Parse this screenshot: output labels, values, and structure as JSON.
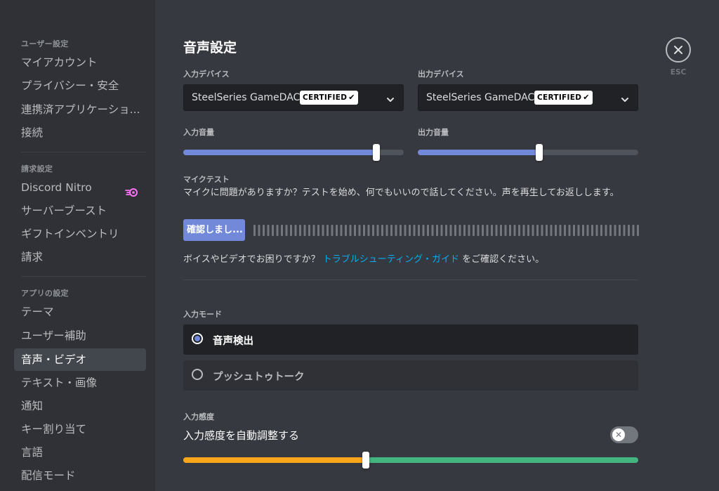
{
  "sidebar": {
    "sections": [
      {
        "label": "ユーザー設定"
      },
      {
        "label": "請求設定"
      },
      {
        "label": "アプリの設定"
      }
    ],
    "items": [
      {
        "label": "マイアカウント"
      },
      {
        "label": "プライバシー・安全"
      },
      {
        "label": "連携済アプリケーショ..."
      },
      {
        "label": "接続"
      },
      {
        "label": "Discord Nitro",
        "icon": "nitro-icon"
      },
      {
        "label": "サーバーブースト"
      },
      {
        "label": "ギフトインベントリ"
      },
      {
        "label": "請求"
      },
      {
        "label": "テーマ"
      },
      {
        "label": "ユーザー補助"
      },
      {
        "label": "音声・ビデオ",
        "selected": true
      },
      {
        "label": "テキスト・画像"
      },
      {
        "label": "通知"
      },
      {
        "label": "キー割り当て"
      },
      {
        "label": "言語"
      },
      {
        "label": "配信モード"
      }
    ]
  },
  "main": {
    "title": "音声設定",
    "input_device": {
      "label": "入力デバイス",
      "value": "SteelSeries GameDAC",
      "badge": "CERTIFIED"
    },
    "output_device": {
      "label": "出力デバイス",
      "value": "SteelSeries GameDAC",
      "badge": "CERTIFIED"
    },
    "input_volume": {
      "label": "入力音量",
      "level": 0.875
    },
    "output_volume": {
      "label": "出力音量",
      "level": 0.55
    },
    "mic_test": {
      "label": "マイクテスト",
      "description": "マイクに問題がありますか？テストを始め、何でもいいので話してください。声を再生してお返しします。",
      "button": "確認しまし..."
    },
    "help": {
      "prefix": "ボイスやビデオでお困りですか？",
      "link": "トラブルシューティング・ガイド",
      "suffix": "をご確認ください。"
    },
    "input_mode": {
      "label": "入力モード",
      "options": [
        {
          "label": "音声検出",
          "selected": true
        },
        {
          "label": "プッシュトゥトーク",
          "selected": false
        }
      ]
    },
    "sensitivity": {
      "label": "入力感度",
      "auto_label": "入力感度を自動調整する",
      "auto_enabled": false,
      "level": 0.402
    }
  },
  "close": {
    "label": "ESC"
  },
  "colors": {
    "accent": "#7289da",
    "yellow": "#faa61a",
    "green": "#43b581",
    "link": "#00b0f4"
  }
}
